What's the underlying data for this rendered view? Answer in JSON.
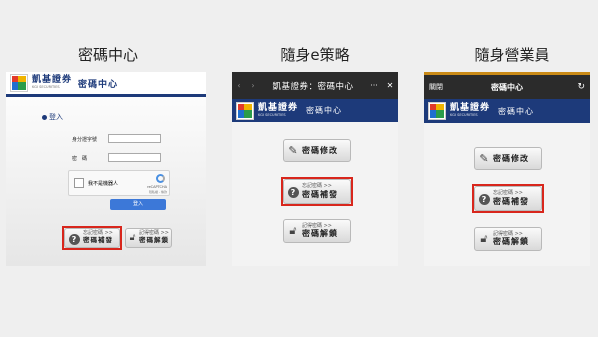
{
  "titles": {
    "left": "密碼中心",
    "middle": "隨身e策略",
    "right": "隨身營業員"
  },
  "brand": {
    "name_zh": "凱基證券",
    "name_en": "KGI SECURITIES",
    "center": "密碼中心"
  },
  "web": {
    "login_link": "登入",
    "id_label": "身分證字號",
    "pwd_label": "密　碼",
    "captcha_label": "我不是機器人",
    "captcha_brand": "reCAPTCHA",
    "captcha_terms": "隱私權 - 條款",
    "login_button": "登入",
    "forgot_small": "忘記密碼 >>",
    "forgot_big": "密碼補發",
    "unlock_small": "記得密碼 >>",
    "unlock_big": "密碼解鎖"
  },
  "estrategy": {
    "header_title": "凱基證券：密碼中心",
    "more": "···",
    "close": "✕",
    "modify_label": "密碼修改",
    "forgot_small": "忘記密碼 >>",
    "forgot_big": "密碼補發",
    "unlock_small": "記得密碼 >>",
    "unlock_big": "密碼解鎖"
  },
  "mobile": {
    "close_label": "關閉",
    "header_title": "密碼中心",
    "refresh": "↻",
    "modify_label": "密碼修改",
    "forgot_small": "忘記密碼 >>",
    "forgot_big": "密碼補發",
    "unlock_small": "記得密碼 >>",
    "unlock_big": "密碼解鎖"
  },
  "colors": {
    "brand_blue": "#1d3a7a",
    "highlight_red": "#d8261c",
    "dark_bar": "#2b2b2b"
  }
}
